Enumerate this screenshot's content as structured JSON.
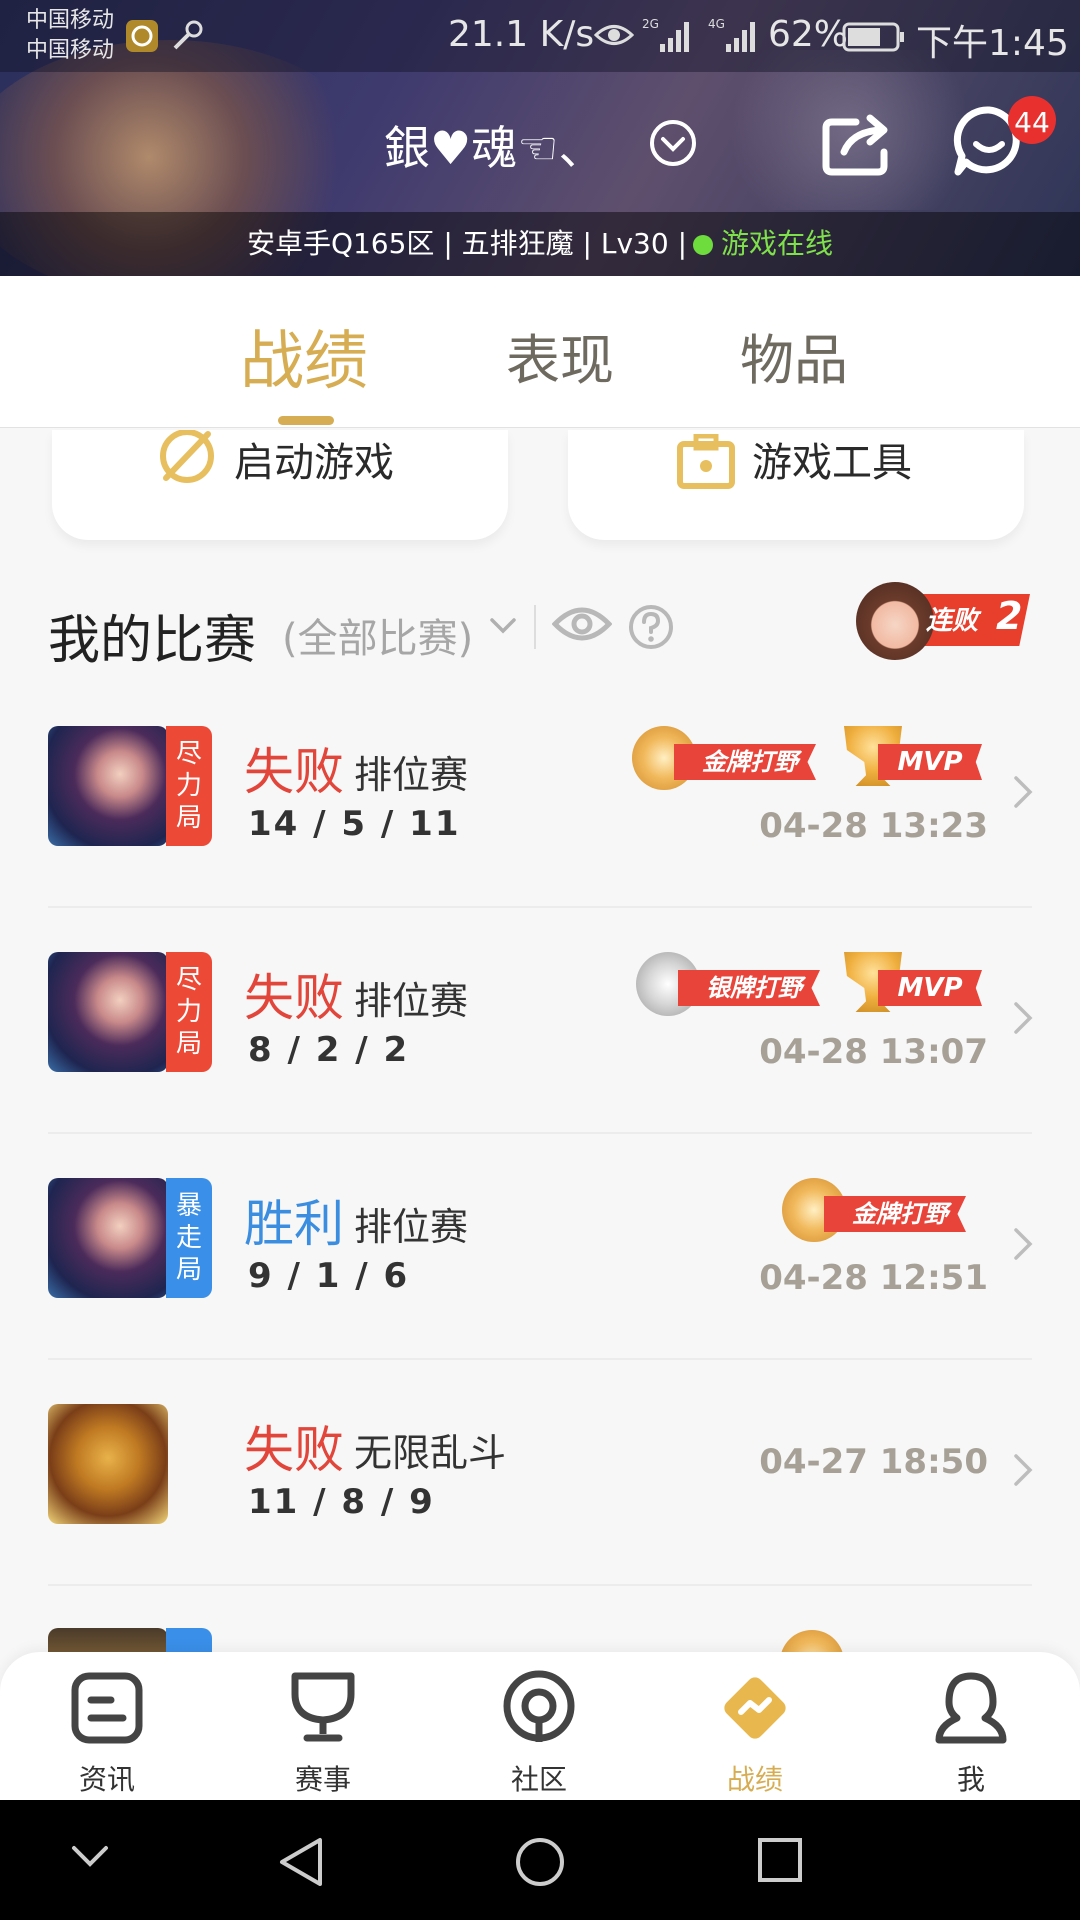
{
  "status_bar": {
    "carrier_1": "中国移动",
    "carrier_2": "中国移动",
    "speed": "21.1 K/s",
    "network_1": "2G",
    "network_2": "4G",
    "battery": "62%",
    "time": "下午1:45"
  },
  "header": {
    "profile_name": "銀♥魂☜、",
    "message_badge": "44",
    "info": "安卓手Q165区 | 五排狂魔 | Lv30 |",
    "online_status": "游戏在线"
  },
  "tabs": [
    {
      "label": "战绩",
      "active": true
    },
    {
      "label": "表现",
      "active": false
    },
    {
      "label": "物品",
      "active": false
    }
  ],
  "tools": {
    "launch_game": "启动游戏",
    "game_tools": "游戏工具"
  },
  "matches_section": {
    "title": "我的比赛",
    "filter": "(全部比赛)",
    "streak_label": "连败",
    "streak_count": "2"
  },
  "matches": [
    {
      "tag": "尽力局",
      "result": "失败",
      "mode": "排位赛",
      "kda": "14 / 5 / 11",
      "time": "04-28 13:23",
      "award": "金牌打野",
      "mvp": "MVP"
    },
    {
      "tag": "尽力局",
      "result": "失败",
      "mode": "排位赛",
      "kda": "8 / 2 / 2",
      "time": "04-28 13:07",
      "award": "银牌打野",
      "mvp": "MVP"
    },
    {
      "tag": "暴走局",
      "result": "胜利",
      "mode": "排位赛",
      "kda": "9 / 1 / 6",
      "time": "04-28 12:51",
      "award": "金牌打野",
      "mvp": ""
    },
    {
      "tag": "",
      "result": "失败",
      "mode": "无限乱斗",
      "kda": "11 / 8 / 9",
      "time": "04-27 18:50",
      "award": "",
      "mvp": ""
    }
  ],
  "bottom_nav": [
    {
      "label": "资讯",
      "icon": "news-icon"
    },
    {
      "label": "赛事",
      "icon": "trophy-icon"
    },
    {
      "label": "社区",
      "icon": "community-icon"
    },
    {
      "label": "战绩",
      "icon": "stats-icon",
      "active": true
    },
    {
      "label": "我",
      "icon": "profile-icon"
    }
  ],
  "colors": {
    "accent_gold": "#d7ad53",
    "lose_red": "#e2453a",
    "win_blue": "#3b8de0",
    "badge_red": "#e8312f",
    "online_green": "#6ddc3c"
  }
}
